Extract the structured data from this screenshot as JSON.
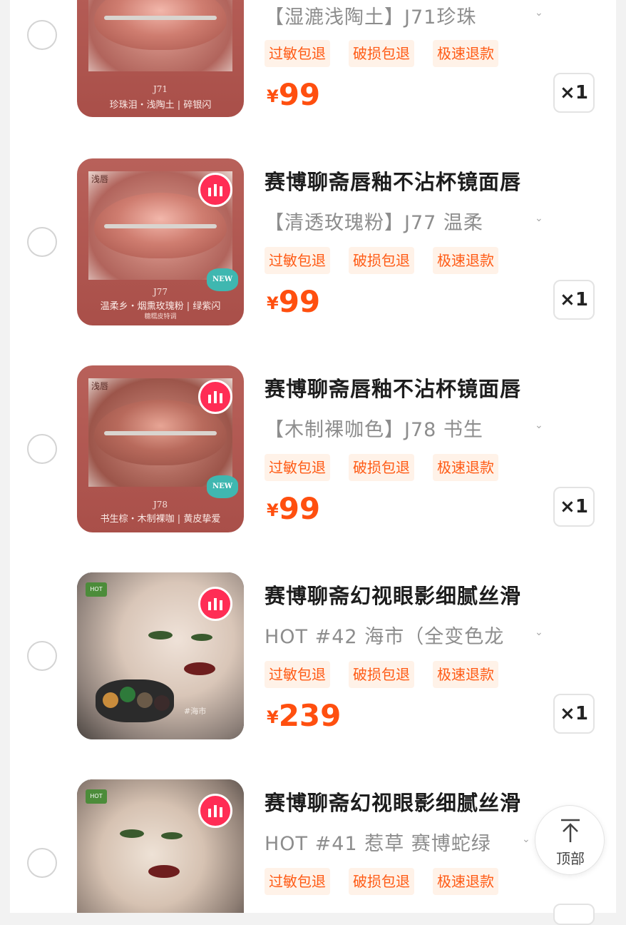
{
  "items": [
    {
      "title": "",
      "variant": "【湿漉浅陶土】J71珍珠",
      "tags": [
        "过敏包退",
        "破损包退",
        "极速退款"
      ],
      "currency": "¥",
      "price": "99",
      "qty": "×1",
      "thumb": {
        "corner": "",
        "code": "J71",
        "caption": "珍珠泪・浅陶土 | 碎银闪",
        "subcap": ""
      }
    },
    {
      "title": "赛博聊斋唇釉不沾杯镜面唇",
      "variant": "【清透玫瑰粉】J77 温柔",
      "tags": [
        "过敏包退",
        "破损包退",
        "极速退款"
      ],
      "currency": "¥",
      "price": "99",
      "qty": "×1",
      "thumb": {
        "corner": "浅唇",
        "code": "J77",
        "caption": "温柔乡・烟熏玫瑰粉 | 绿紫闪",
        "subcap": "糖糯皮特调",
        "new": "NEW"
      }
    },
    {
      "title": "赛博聊斋唇釉不沾杯镜面唇",
      "variant": "【木制裸咖色】J78 书生",
      "tags": [
        "过敏包退",
        "破损包退",
        "极速退款"
      ],
      "currency": "¥",
      "price": "99",
      "qty": "×1",
      "thumb": {
        "corner": "浅唇",
        "code": "J78",
        "caption": "书生棕・木制裸咖 | 黄皮挚爱",
        "subcap": "",
        "new": "NEW"
      }
    },
    {
      "title": "赛博聊斋幻视眼影细腻丝滑",
      "variant": "HOT #42 海市（全变色龙",
      "tags": [
        "过敏包退",
        "破损包退",
        "极速退款"
      ],
      "currency": "¥",
      "price": "239",
      "qty": "×1",
      "thumb": {
        "hot": "HOT",
        "shade": "#海市"
      }
    },
    {
      "title": "赛博聊斋幻视眼影细腻丝滑",
      "variant": "HOT #41 惹草  赛博蛇绿",
      "tags": [
        "过敏包退",
        "破损包退",
        "极速退款"
      ],
      "currency": "¥",
      "price": "",
      "qty": "",
      "thumb": {
        "hot": "HOT",
        "shade": ""
      }
    }
  ],
  "back_to_top": {
    "label": "顶部",
    "icon": "arrow-up-icon"
  },
  "colors": {
    "accent": "#ff4f0f",
    "tag_bg": "#fff2e8",
    "app_badge": "#ff2d55"
  }
}
